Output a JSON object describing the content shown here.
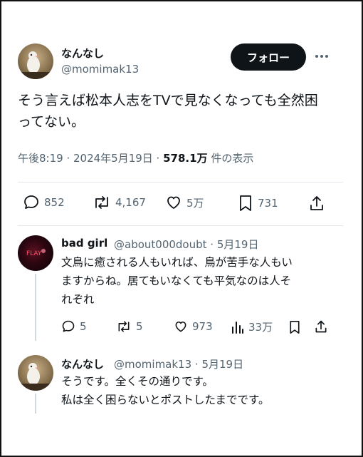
{
  "main_tweet": {
    "display_name": "なんなし",
    "handle": "@momimak13",
    "follow_label": "フォロー",
    "text_line1": "そう言えば松本人志をTVで見なくなっても全然困",
    "text_line2": "ってない。",
    "time": "午後8:19 · 2024年5月19日 · ",
    "views_count": "578.1万",
    "views_label": " 件の表示",
    "stats": {
      "replies": "852",
      "reposts": "4,167",
      "likes": "5万",
      "bookmarks": "731"
    }
  },
  "replies": [
    {
      "display_name": "bad girl",
      "handle_date": "@about000doubt · 5月19日",
      "lines": [
        "文鳥に癒される人もいれば、鳥が苦手な人もい",
        "ますからね。居てもいなくても平気なのは人そ",
        "れぞれ"
      ],
      "stats": {
        "replies": "5",
        "reposts": "5",
        "likes": "973",
        "views": "33万"
      }
    },
    {
      "display_name": "なんなし",
      "handle_date": "@momimak13 · 5月19日",
      "lines": [
        "そうです。全くその通りです。",
        "私は全く困らないとポストしたまでです。"
      ]
    }
  ],
  "colors": {
    "text": "#0f1419",
    "secondary": "#536471",
    "divider": "#e4e8ec",
    "button": "#0f1419"
  },
  "icons": [
    "reply-icon",
    "repost-icon",
    "like-icon",
    "bookmark-icon",
    "share-icon",
    "views-icon",
    "more-icon"
  ]
}
